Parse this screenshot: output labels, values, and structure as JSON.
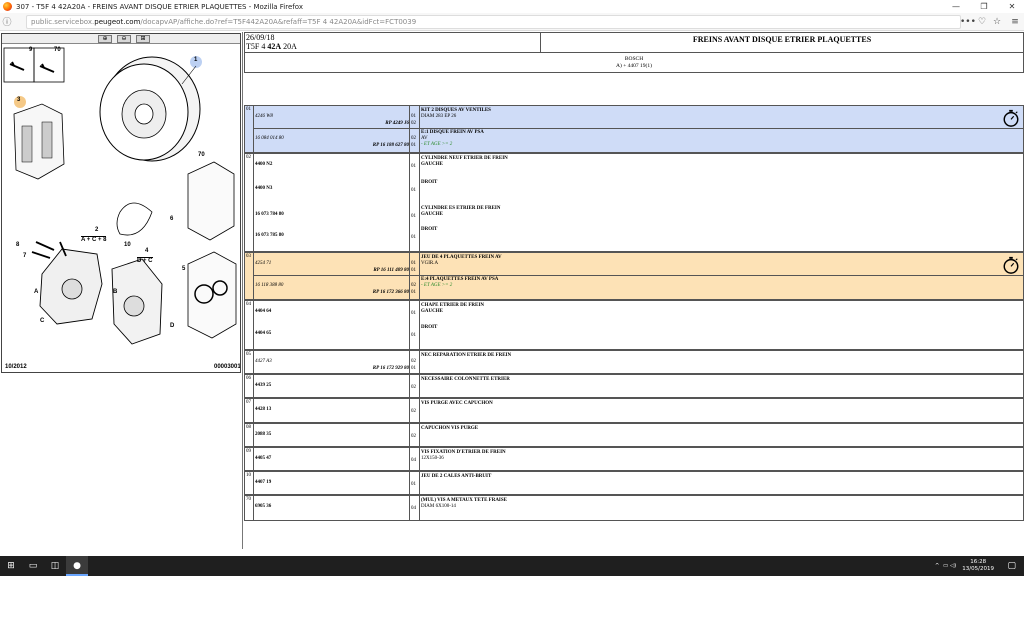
{
  "window": {
    "title": "307 - T5F 4 42A20A - FREINS AVANT DISQUE ETRIER PLAQUETTES - Mozilla Firefox",
    "minimize": "—",
    "restore": "❐",
    "close": "✕"
  },
  "urlbar": {
    "prefix": "public.servicebox.",
    "domain": "peugeot.com",
    "path": "/docapvAP/affiche.do?ref=T5F442A20A&refaff=T5F 4 42A20A&idFct=FCT0039",
    "more": "•••",
    "pocket": "♡",
    "star": "☆",
    "menu": "≡"
  },
  "diagram": {
    "date": "10/2012",
    "ref": "00003001",
    "labels": [
      "9",
      "70",
      "1",
      "3",
      "70",
      "2",
      "A + C + 8",
      "6",
      "8",
      "7",
      "10",
      "4",
      "D + C",
      "5",
      "A",
      "B",
      "C",
      "D"
    ]
  },
  "header": {
    "date": "26/09/18",
    "model_prefix": "T5F 4",
    "model_bold": "42A",
    "model_suffix": "20A",
    "title": "FREINS AVANT DISQUE ETRIER PLAQUETTES",
    "brand": "BOSCH",
    "brand_note": "A) + 4407 19(1)"
  },
  "parts": [
    {
      "num": "01",
      "lines": [
        {
          "ref": "4246 W8",
          "ref_style": "ital",
          "rp": "RP 4249 J6",
          "qty": "01",
          "qty2": "02",
          "desc": [
            "KIT 2 DISQUES AV VENTILES",
            "DIAM 283 EP 26"
          ],
          "desc_bold": [
            true,
            false
          ]
        },
        {
          "ref": "16 084 014 80",
          "ref_style": "ital",
          "rp": "RP 16 188 627 80",
          "qty": "02",
          "qty2": "01",
          "desc": [
            "E:1 DISQUE FREIN AV PSA",
            "AV",
            "- ET AGE >= 2"
          ],
          "desc_bold": [
            true,
            false,
            false
          ]
        }
      ]
    },
    {
      "num": "02",
      "lines": [
        {
          "ref": "4400 N2",
          "ref_style": "bold",
          "qty": "01",
          "desc": [
            "CYLINDRE NEUF ETRIER DE FREIN",
            "GAUCHE"
          ],
          "desc_bold": [
            true,
            true
          ]
        },
        {
          "ref": "4400 N3",
          "ref_style": "bold",
          "qty": "01",
          "desc": [
            "DROIT"
          ],
          "desc_bold": [
            true
          ]
        },
        {
          "ref": "16 073 784 80",
          "ref_style": "bold",
          "qty": "01",
          "desc": [
            "CYLINDRE ES ETRIER DE FREIN",
            "GAUCHE"
          ],
          "desc_bold": [
            true,
            true
          ]
        },
        {
          "ref": "16 073 785 80",
          "ref_style": "bold",
          "qty": "01",
          "desc": [
            "DROIT"
          ],
          "desc_bold": [
            true
          ]
        }
      ]
    },
    {
      "num": "03",
      "lines": [
        {
          "ref": "4254 71",
          "ref_style": "ital",
          "rp": "RP 16 111 409 80",
          "qty": "01",
          "qty2": "01",
          "desc": [
            "JEU DE 4 PLAQUETTES FREIN AV",
            "VGIR.A"
          ],
          "desc_bold": [
            true,
            false
          ]
        },
        {
          "ref": "16 118 388 80",
          "ref_style": "ital",
          "rp": "RP 16 172 366 80",
          "qty": "02",
          "qty2": "01",
          "desc": [
            "E:4 PLAQUETTES FREIN AV PSA",
            "- ET AGE >= 2"
          ],
          "desc_bold": [
            true,
            false
          ]
        }
      ]
    },
    {
      "num": "04",
      "lines": [
        {
          "ref": "4404 64",
          "ref_style": "bold",
          "qty": "01",
          "desc": [
            "CHAPE ETRIER DE FREIN",
            "GAUCHE"
          ],
          "desc_bold": [
            true,
            true
          ]
        },
        {
          "ref": "4404 65",
          "ref_style": "bold",
          "qty": "01",
          "desc": [
            "DROIT"
          ],
          "desc_bold": [
            true
          ]
        }
      ]
    },
    {
      "num": "05",
      "lines": [
        {
          "ref": "4427 A3",
          "ref_style": "ital",
          "rp": "RP 16 172 929 80",
          "qty": "02",
          "qty2": "01",
          "desc": [
            "NEC REPARATION ETRIER DE FREIN"
          ],
          "desc_bold": [
            true
          ]
        }
      ]
    },
    {
      "num": "06",
      "lines": [
        {
          "ref": "4439 25",
          "ref_style": "bold",
          "qty": "02",
          "desc": [
            "NECESSAIRE COLONNETTE ETRIER"
          ],
          "desc_bold": [
            true
          ]
        }
      ]
    },
    {
      "num": "07",
      "lines": [
        {
          "ref": "4428 13",
          "ref_style": "bold",
          "qty": "02",
          "desc": [
            "VIS PURGE AVEC CAPUCHON"
          ],
          "desc_bold": [
            true
          ]
        }
      ]
    },
    {
      "num": "08",
      "lines": [
        {
          "ref": "2088 35",
          "ref_style": "bold",
          "qty": "02",
          "desc": [
            "CAPUCHON VIS PURGE"
          ],
          "desc_bold": [
            true
          ]
        }
      ]
    },
    {
      "num": "09",
      "lines": [
        {
          "ref": "4405 47",
          "ref_style": "bold",
          "qty": "04",
          "desc": [
            "VIS FIXATION D'ETRIER DE FREIN",
            "12X150-36"
          ],
          "desc_bold": [
            true,
            false
          ]
        }
      ]
    },
    {
      "num": "10",
      "lines": [
        {
          "ref": "4407 19",
          "ref_style": "bold",
          "qty": "01",
          "desc": [
            "JEU DE 2 CALES ANTI-BRUIT"
          ],
          "desc_bold": [
            true
          ]
        }
      ]
    },
    {
      "num": "70",
      "lines": [
        {
          "ref": "6905 36",
          "ref_style": "bold",
          "qty": "04",
          "desc": [
            "(MUL) VIS A METAUX TETE FRAISE",
            "DIAM 6X100-14"
          ],
          "desc_bold": [
            true,
            false
          ]
        }
      ]
    }
  ],
  "taskbar": {
    "time": "16:28",
    "date": "13/05/2019"
  },
  "colors": {
    "highlight_blue": "#cfdcf7",
    "highlight_orange": "#fde2b6",
    "green_note": "#2a8a2a"
  }
}
